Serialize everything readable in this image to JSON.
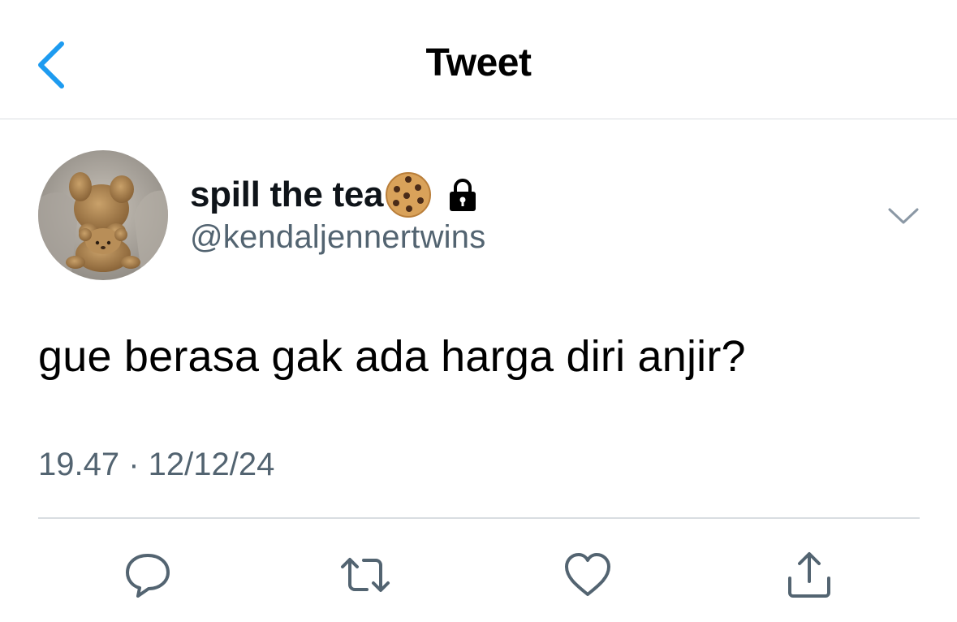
{
  "header": {
    "title": "Tweet",
    "back_icon": "chevron-left-icon"
  },
  "tweet": {
    "author": {
      "display_name": "spill the tea",
      "handle": "@kendaljennertwins",
      "avatar": "teddy-bear-avatar",
      "badges": [
        "cookie-emoji-icon",
        "lock-icon"
      ]
    },
    "text": "gue berasa gak ada harga diri anjir?",
    "timestamp": "19.47 · 12/12/24"
  },
  "actions": {
    "items": [
      "reply-icon",
      "retweet-icon",
      "like-icon",
      "share-icon"
    ]
  },
  "colors": {
    "accent": "#1d9bf0",
    "secondary_text": "#536471",
    "divider": "#d9dde1",
    "icon": "#536471"
  }
}
